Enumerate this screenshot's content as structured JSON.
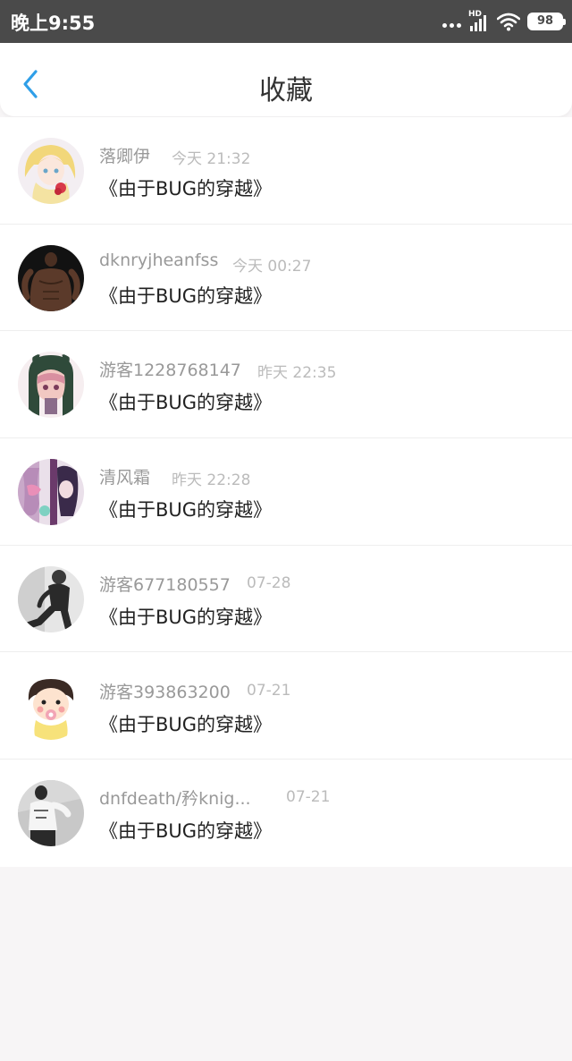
{
  "status_bar": {
    "time": "晚上9:55",
    "network_label": "HD",
    "battery": "98"
  },
  "header": {
    "title": "收藏"
  },
  "items": [
    {
      "name": "落卿伊",
      "time": "今天 21:32",
      "content": "《由于BUG的穿越》"
    },
    {
      "name": "dknryjheanfss",
      "time": "今天 00:27",
      "content": "《由于BUG的穿越》"
    },
    {
      "name": "游客1228768147",
      "time": "昨天 22:35",
      "content": "《由于BUG的穿越》"
    },
    {
      "name": "清风霜",
      "time": "昨天 22:28",
      "content": "《由于BUG的穿越》"
    },
    {
      "name": "游客677180557",
      "time": "07-28",
      "content": "《由于BUG的穿越》"
    },
    {
      "name": "游客393863200",
      "time": "07-21",
      "content": "《由于BUG的穿越》"
    },
    {
      "name": "dnfdeath/矜knig...",
      "time": "07-21",
      "content": "《由于BUG的穿越》"
    }
  ],
  "colors": {
    "accent": "#2f9fe8",
    "title": "#333333",
    "meta": "#999999",
    "time": "#bbbbbb"
  }
}
